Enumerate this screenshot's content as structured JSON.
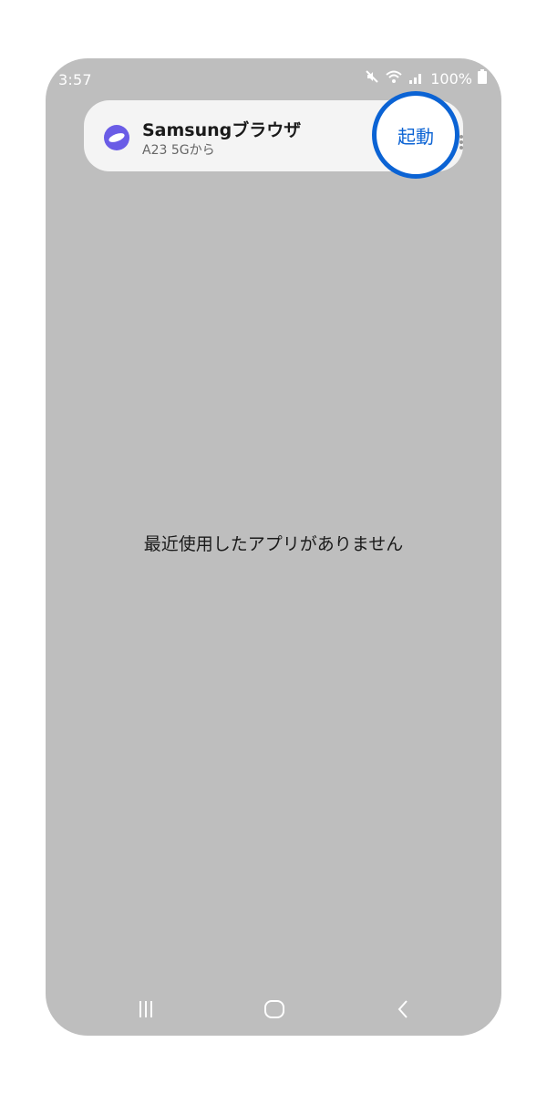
{
  "status_bar": {
    "time": "3:57",
    "battery": "100%"
  },
  "notification": {
    "app_name": "Samsungブラウザ",
    "source": "A23 5Gから",
    "action_label": "起動",
    "icon": "samsung-internet-icon"
  },
  "recents": {
    "empty_message": "最近使用したアプリがありません"
  },
  "colors": {
    "background": "#bebebe",
    "accent": "#0b63d4",
    "app_icon": "#6a5ce6"
  }
}
